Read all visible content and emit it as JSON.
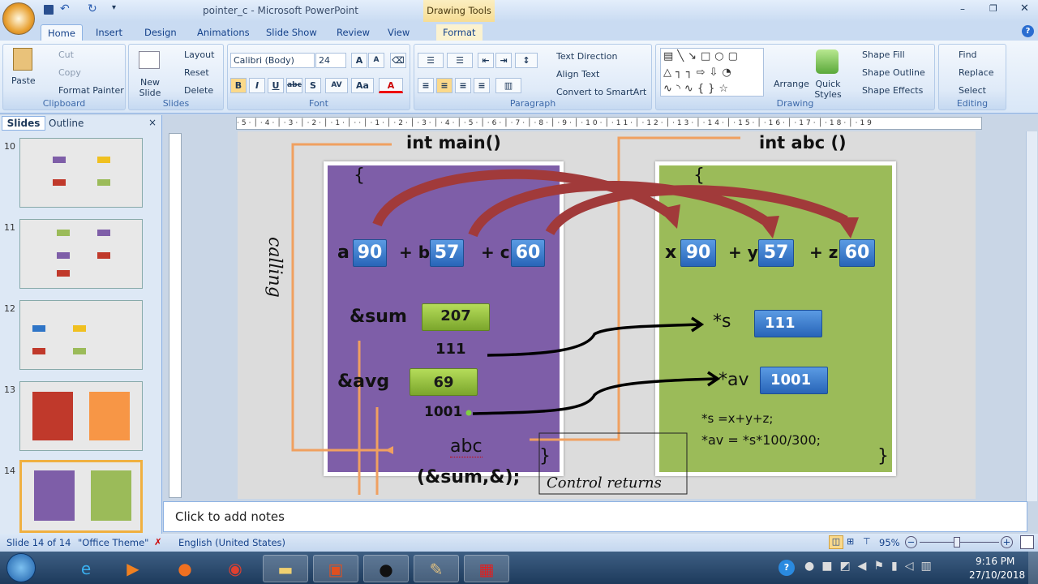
{
  "window": {
    "title": "pointer_c - Microsoft PowerPoint",
    "context_tab_group": "Drawing Tools"
  },
  "tabs": [
    "Home",
    "Insert",
    "Design",
    "Animations",
    "Slide Show",
    "Review",
    "View",
    "Format"
  ],
  "ribbon": {
    "clipboard": {
      "label": "Clipboard",
      "paste": "Paste",
      "cut": "Cut",
      "copy": "Copy",
      "format_painter": "Format Painter"
    },
    "slides": {
      "label": "Slides",
      "new_slide": "New Slide",
      "layout": "Layout",
      "reset": "Reset",
      "delete": "Delete"
    },
    "font": {
      "label": "Font",
      "font_name": "Calibri (Body)",
      "font_size": "24"
    },
    "paragraph": {
      "label": "Paragraph",
      "text_direction": "Text Direction",
      "align_text": "Align Text",
      "convert": "Convert to SmartArt"
    },
    "drawing": {
      "label": "Drawing",
      "arrange": "Arrange",
      "quick_styles": "Quick Styles",
      "shape_fill": "Shape Fill",
      "shape_outline": "Shape Outline",
      "shape_effects": "Shape Effects"
    },
    "editing": {
      "label": "Editing",
      "find": "Find",
      "replace": "Replace",
      "select": "Select"
    }
  },
  "panel": {
    "tabs": [
      "Slides",
      "Outline"
    ],
    "thumbnails": [
      "10",
      "11",
      "12",
      "13",
      "14"
    ],
    "selected": "14"
  },
  "slide": {
    "main_title": "int main()",
    "abc_title": "int abc ()",
    "open_brace": "{",
    "close_brace": "}",
    "calling": "calling",
    "main_vars": [
      {
        "name": "a",
        "value": "90"
      },
      {
        "name": "+ b",
        "value": "57"
      },
      {
        "name": "+ c",
        "value": "60"
      }
    ],
    "abc_vars": [
      {
        "name": "x",
        "value": "90"
      },
      {
        "name": "+ y",
        "value": "57"
      },
      {
        "name": "+ z",
        "value": "60"
      }
    ],
    "sum_label": "&sum",
    "sum_value": "207",
    "sum_addr": "111",
    "avg_label": "&avg",
    "avg_value": "69",
    "avg_addr": "1001",
    "call_name": "abc",
    "call_args": "(&sum,&);",
    "ptr_s": "*s",
    "ptr_s_value": "111",
    "ptr_av": "*av",
    "ptr_av_value": "1001",
    "code1": "*s =x+y+z;",
    "code2": "*av = *s*100/300;",
    "control_returns": "Control returns",
    "colors": {
      "main_box": "#7e5ea8",
      "abc_box": "#9bbb59",
      "value_box": "#2f75c7",
      "result_box": "#92c23c",
      "arrow": "#a13a3a",
      "flow": "#f0a060"
    }
  },
  "notes": {
    "placeholder": "Click to add notes"
  },
  "status": {
    "slide": "Slide 14 of 14",
    "theme": "\"Office Theme\"",
    "language": "English (United States)",
    "zoom": "95%",
    "zoom_percent": 95
  },
  "taskbar": {
    "time": "9:16 PM",
    "date": "27/10/2018"
  }
}
